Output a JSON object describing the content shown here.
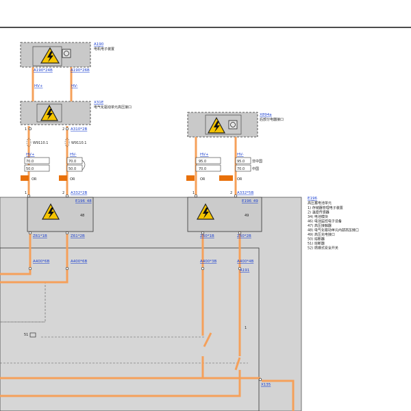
{
  "diagram": {
    "components": {
      "a190": {
        "ref": "A190",
        "desc": "电机电子装置",
        "pin_left": "A190*24B",
        "pin_right": "A190*26B"
      },
      "x31e": {
        "ref": "X31E",
        "desc": "电气化驱动单元高压接口",
        "pin_left": "A310*2B",
        "num_left": "1",
        "num_right": "2"
      },
      "x894a": {
        "ref": "X894a",
        "desc": "后部分电器接口"
      },
      "e196": {
        "ref": "E196",
        "title": "高压蓄电池单元",
        "legend": [
          "1)  存储器管理电子装置",
          "2)  温度传感器",
          "34) 电池模块",
          "46) 电池监控电子设备",
          "47) 高压接触器",
          "48) 电气化驱动单元内部高压接口",
          "49) 高压充电接口",
          "50) 熔断器",
          "51) 熔断器",
          "52) 燃爆式安全开关"
        ]
      }
    },
    "left_block": {
      "hv_plus": "HV+",
      "hv_minus": "HV-",
      "wire_left": "W9110.1",
      "wire_right": "W9110.1",
      "cs_left": "70.0",
      "cs_right": "70.0",
      "len_left": "50.0",
      "len_right": "50.0",
      "color_left": "OR",
      "color_right": "OR",
      "num_left": "1",
      "num_right": "2",
      "pin_a332": "A332*2B",
      "e196_tag": "E196_48",
      "inner_num": "48",
      "z_left": "Z61*1B",
      "z_right": "Z61*2B",
      "a400_left": "A400*6B",
      "a400_right": "A400*6B"
    },
    "right_block": {
      "hv_plus": "HV+",
      "hv_minus": "HV-",
      "cs_left": "95.0",
      "cs_right": "95.0",
      "len_left": "70.0",
      "len_right": "70.0",
      "note_1": "非中国",
      "note_2": "中国",
      "color_left": "OR",
      "color_right": "OR",
      "num_left": "1",
      "num_right": "2",
      "pin_a332": "A332*5B",
      "e196_tag": "E196_49",
      "inner_num": "49",
      "z_left": "Z60*1B",
      "z_right": "Z60*2B",
      "a400_left": "A400*3B",
      "a400_right": "A400*4B",
      "a191": "A191"
    },
    "inner": {
      "label_51": "51",
      "label_1": "1",
      "x135": "X135"
    },
    "colors": {
      "hv_wire": "#f5a05a",
      "panel_gray": "#d3d3d3",
      "box_gray": "#c9c9c9",
      "link": "#1a3fd0",
      "orange_tag": "#e8700a"
    },
    "icons": [
      "high-voltage-warning-icon",
      "gear-component-icon"
    ]
  }
}
